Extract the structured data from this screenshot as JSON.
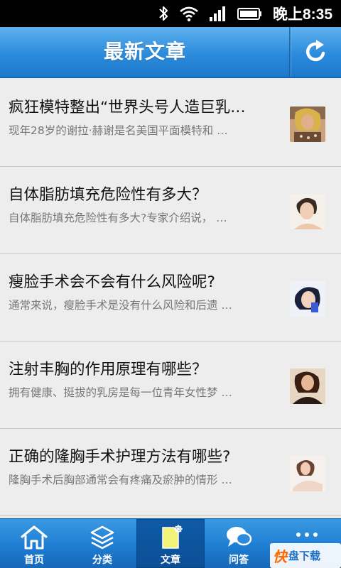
{
  "status_bar": {
    "time": "晚上8:35",
    "icons": [
      "bluetooth-icon",
      "wifi-icon",
      "signal-icon",
      "battery-icon"
    ]
  },
  "header": {
    "title": "最新文章",
    "refresh_icon": "refresh-icon"
  },
  "articles": [
    {
      "title": "疯狂模特整出“世界头号人造巨乳…",
      "summary": "现年28岁的谢拉·赫谢是名美国平面模特和 …"
    },
    {
      "title": "自体脂肪填充危险性有多大？",
      "summary": "自体脂肪填充危险性有多大?专家介绍说， …"
    },
    {
      "title": "瘦脸手术会不会有什么风险呢?",
      "summary": "通常来说，瘦脸手术是没有什么风险和后遗 …"
    },
    {
      "title": "注射丰胸的作用原理有哪些？",
      "summary": "拥有健康、挺拔的乳房是每一位青年女性梦 …"
    },
    {
      "title": "正确的隆胸手术护理方法有哪些?",
      "summary": "隆胸手术后胸部通常会有疼痛及瘀肿的情形 …"
    }
  ],
  "tabs": [
    {
      "label": "首页",
      "icon": "home-icon",
      "active": false
    },
    {
      "label": "分类",
      "icon": "layers-icon",
      "active": false
    },
    {
      "label": "文章",
      "icon": "document-icon",
      "active": true
    },
    {
      "label": "问答",
      "icon": "chat-bubble-icon",
      "active": false
    },
    {
      "label": "",
      "icon": "more-icon",
      "active": false
    }
  ],
  "watermark": {
    "logo": "快",
    "text": "盘下载"
  },
  "colors": {
    "header_blue": "#2b8bdc",
    "tab_active": "#0e5aa6",
    "background": "#ededed"
  }
}
